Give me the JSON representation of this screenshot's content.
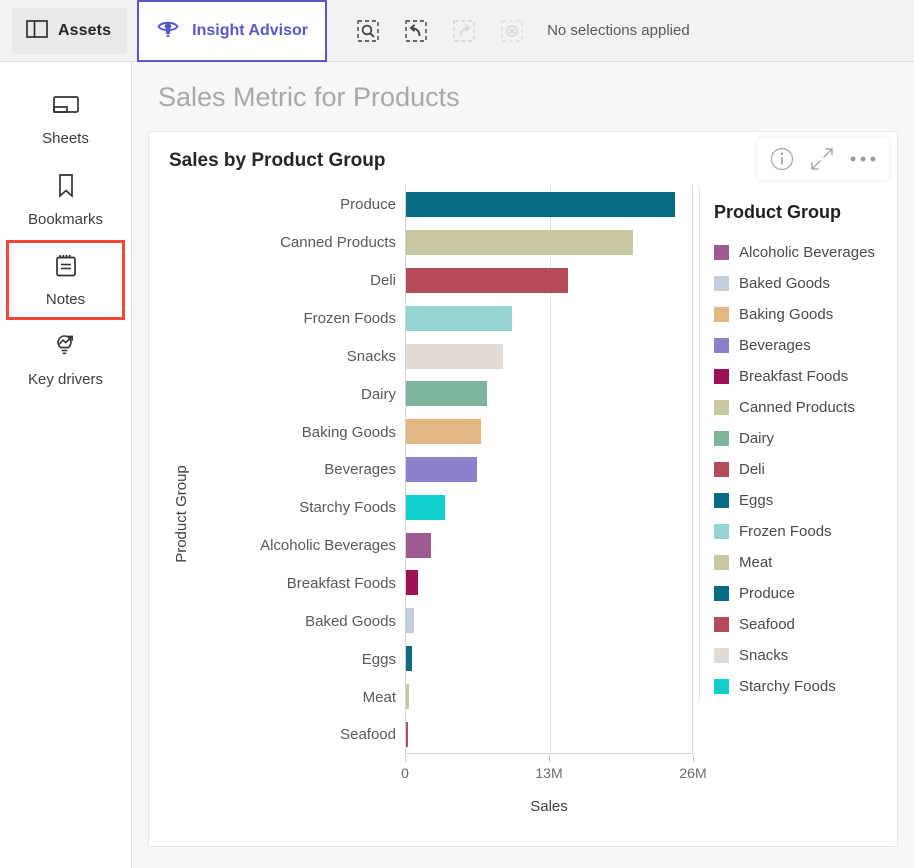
{
  "toolbar": {
    "assets_label": "Assets",
    "assets_icon": "panel-layout-icon",
    "insight_advisor_label": "Insight Advisor",
    "insight_advisor_icon": "insight-advisor-eye-icon",
    "selection_status": "No selections applied",
    "buttons": [
      {
        "name": "search-selections-icon",
        "label": "Search in selections",
        "disabled": false
      },
      {
        "name": "step-back-icon",
        "label": "Step back",
        "disabled": false
      },
      {
        "name": "step-forward-icon",
        "label": "Step forward",
        "disabled": true
      },
      {
        "name": "clear-selections-icon",
        "label": "Clear all selections",
        "disabled": true
      }
    ],
    "accent_color": "#5a58c8",
    "top_accent_color": "#0E8A4E"
  },
  "sidebar": {
    "items": [
      {
        "label": "Sheets",
        "icon": "sheets-icon",
        "highlighted": false
      },
      {
        "label": "Bookmarks",
        "icon": "bookmark-icon",
        "highlighted": false
      },
      {
        "label": "Notes",
        "icon": "notes-icon",
        "highlighted": true
      },
      {
        "label": "Key drivers",
        "icon": "key-drivers-icon",
        "highlighted": false
      }
    ],
    "highlight_color": "#f5483b"
  },
  "main": {
    "page_title": "Sales Metric for Products",
    "card": {
      "title": "Sales by Product Group",
      "actions": [
        {
          "name": "info-icon",
          "label": "Info"
        },
        {
          "name": "fullscreen-icon",
          "label": "Fullscreen"
        },
        {
          "name": "more-options-icon",
          "label": "More options"
        }
      ]
    }
  },
  "chart_data": {
    "type": "bar",
    "orientation": "horizontal",
    "title": "Sales by Product Group",
    "xlabel": "Sales",
    "ylabel": "Product Group",
    "xlim": [
      0,
      26000000
    ],
    "xticks": [
      0,
      13000000,
      26000000
    ],
    "xtick_labels": [
      "0",
      "13M",
      "26M"
    ],
    "grid": true,
    "legend_title": "Product Group",
    "legend_position": "right",
    "categories": [
      "Produce",
      "Canned Products",
      "Deli",
      "Frozen Foods",
      "Snacks",
      "Dairy",
      "Baking Goods",
      "Beverages",
      "Starchy Foods",
      "Alcoholic Beverages",
      "Breakfast Foods",
      "Baked Goods",
      "Eggs",
      "Meat",
      "Seafood"
    ],
    "values": [
      24400000,
      20600000,
      14700000,
      9600000,
      8800000,
      7300000,
      6800000,
      6400000,
      3500000,
      2300000,
      1100000,
      700000,
      550000,
      250000,
      200000
    ],
    "bar_colors": [
      "#0A6B85",
      "#C9C79F",
      "#B34C58",
      "#96D5D2",
      "#E2DAD4",
      "#7EB49B",
      "#E2B781",
      "#8A80CB",
      "#11CFCB",
      "#9D5B92",
      "#9E1155",
      "#C3CEDA",
      "#0A6B85",
      "#C9C79F",
      "#B34C58"
    ],
    "legend_entries": [
      {
        "label": "Alcoholic Beverages",
        "color": "#9D5B92"
      },
      {
        "label": "Baked Goods",
        "color": "#C3CEDA"
      },
      {
        "label": "Baking Goods",
        "color": "#E2B781"
      },
      {
        "label": "Beverages",
        "color": "#8A80CB"
      },
      {
        "label": "Breakfast Foods",
        "color": "#9E1155"
      },
      {
        "label": "Canned Products",
        "color": "#C9C79F"
      },
      {
        "label": "Dairy",
        "color": "#7EB49B"
      },
      {
        "label": "Deli",
        "color": "#B34C58"
      },
      {
        "label": "Eggs",
        "color": "#0A6B85"
      },
      {
        "label": "Frozen Foods",
        "color": "#96D5D2"
      },
      {
        "label": "Meat",
        "color": "#C9C79F"
      },
      {
        "label": "Produce",
        "color": "#0A6B85"
      },
      {
        "label": "Seafood",
        "color": "#B34C58"
      },
      {
        "label": "Snacks",
        "color": "#E2DAD4"
      },
      {
        "label": "Starchy Foods",
        "color": "#11CFCB"
      }
    ]
  }
}
